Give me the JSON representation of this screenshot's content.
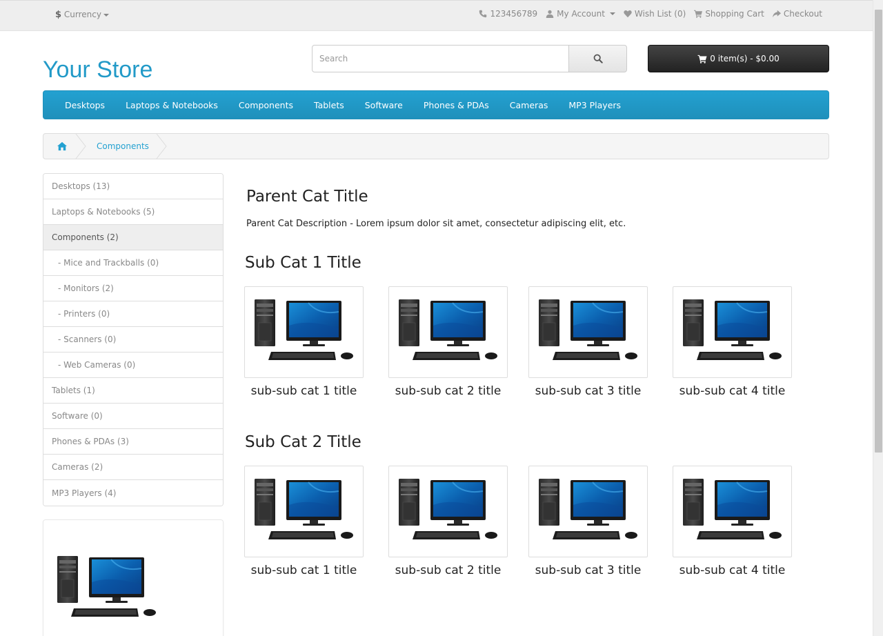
{
  "topbar": {
    "currency_symbol": "$",
    "currency_label": "Currency",
    "phone": "123456789",
    "my_account": "My Account",
    "wish_list": "Wish List (0)",
    "shopping_cart": "Shopping Cart",
    "checkout": "Checkout"
  },
  "header": {
    "logo": "Your Store",
    "search_placeholder": "Search",
    "cart_label": "0 item(s) - $0.00"
  },
  "menu": {
    "items": [
      "Desktops",
      "Laptops & Notebooks",
      "Components",
      "Tablets",
      "Software",
      "Phones & PDAs",
      "Cameras",
      "MP3 Players"
    ]
  },
  "breadcrumb": {
    "current": "Components"
  },
  "sidebar": {
    "categories": [
      "Desktops (13)",
      "Laptops & Notebooks (5)",
      "Components (2)",
      "- Mice and Trackballs (0)",
      "- Monitors (2)",
      "- Printers (0)",
      "- Scanners (0)",
      "- Web Cameras (0)",
      "Tablets (1)",
      "Software (0)",
      "Phones & PDAs (3)",
      "Cameras (2)",
      "MP3 Players (4)"
    ]
  },
  "main": {
    "parent_title": "Parent Cat Title",
    "parent_description": "Parent Cat Description - Lorem ipsum dolor sit amet, consectetur adipiscing elit, etc.",
    "subcats": [
      {
        "title": "Sub Cat 1 Title",
        "items": [
          "sub-sub cat 1 title",
          "sub-sub cat 2 title",
          "sub-sub cat 3 title",
          "sub-sub cat 4 title"
        ]
      },
      {
        "title": "Sub Cat 2 Title",
        "items": [
          "sub-sub cat 1 title",
          "sub-sub cat 2 title",
          "sub-sub cat 3 title",
          "sub-sub cat 4 title"
        ]
      }
    ]
  },
  "colors": {
    "brand": "#229ac8",
    "menu_bg": "#23a1d1",
    "cart_bg": "#303030"
  }
}
